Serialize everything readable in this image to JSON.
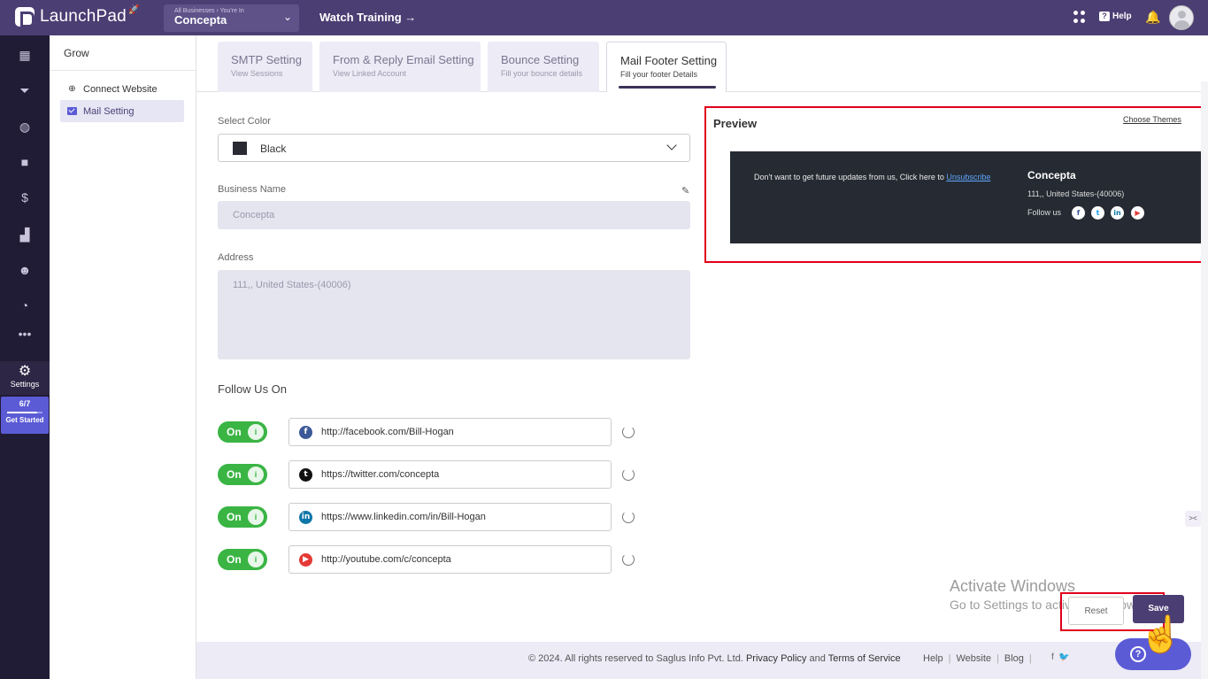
{
  "topbar": {
    "app_name": "LaunchPad",
    "business_caption": "All Businesses › You're In",
    "business_name": "Concepta",
    "watch_training": "Watch Training →",
    "help_label": "Help"
  },
  "rail": {
    "items": [
      "dashboard-icon",
      "funnel-icon",
      "globe-icon",
      "video-icon",
      "dollar-icon",
      "analytics-icon",
      "users-icon",
      "reports-icon",
      "more-icon"
    ],
    "settings_label": "Settings",
    "progress_text": "6/7",
    "progress_fraction": 0.86,
    "get_started_label": "Get Started"
  },
  "subnav": {
    "title": "Grow",
    "items": [
      {
        "label": "Connect Website",
        "icon": "link-icon",
        "active": false
      },
      {
        "label": "Mail Setting",
        "icon": "mail-icon",
        "active": true
      }
    ]
  },
  "tabs": [
    {
      "title": "SMTP Setting",
      "subtitle": "View Sessions"
    },
    {
      "title": "From & Reply Email Setting",
      "subtitle": "View Linked Account"
    },
    {
      "title": "Bounce Setting",
      "subtitle": "Fill your bounce details"
    },
    {
      "title": "Mail Footer Setting",
      "subtitle": "Fill your footer Details",
      "active": true
    }
  ],
  "form": {
    "select_color_label": "Select Color",
    "select_color_value": "Black",
    "swatch_color": "#2a2a33",
    "business_name_label": "Business Name",
    "business_name_value": "Concepta",
    "address_label": "Address",
    "address_value": "111,, United States-(40006)",
    "follow_heading": "Follow Us On",
    "toggle_label": "On",
    "socials": [
      {
        "network": "facebook",
        "url": "http://facebook.com/Bill-Hogan",
        "glyph": "f",
        "color": "#3b5998"
      },
      {
        "network": "twitter",
        "url": "https://twitter.com/concepta",
        "glyph": "t",
        "color": "#111111"
      },
      {
        "network": "linkedin",
        "url": "https://www.linkedin.com/in/Bill-Hogan",
        "glyph": "in",
        "color": "#0e76a8"
      },
      {
        "network": "youtube",
        "url": "http://youtube.com/c/concepta",
        "glyph": "▶",
        "color": "#e53935"
      }
    ]
  },
  "preview": {
    "title": "Preview",
    "choose_themes": "Choose Themes",
    "unsub_text": "Don't want to get future updates from us, Click here to ",
    "unsub_link": "Unsubscribe",
    "business": "Concepta",
    "address": "111,, United States-(40006)",
    "follow_label": "Follow us"
  },
  "actions": {
    "reset_label": "Reset",
    "save_label": "Save"
  },
  "watermark": {
    "line1": "Activate Windows",
    "line2": "Go to Settings to activate Windows."
  },
  "footer": {
    "copyright": "© 2024. All rights reserved to Saglus Info Pvt. Ltd.",
    "privacy": "Privacy Policy",
    "and": "and",
    "terms": "Terms of Service",
    "links": [
      "Help",
      "Website",
      "Blog"
    ]
  }
}
